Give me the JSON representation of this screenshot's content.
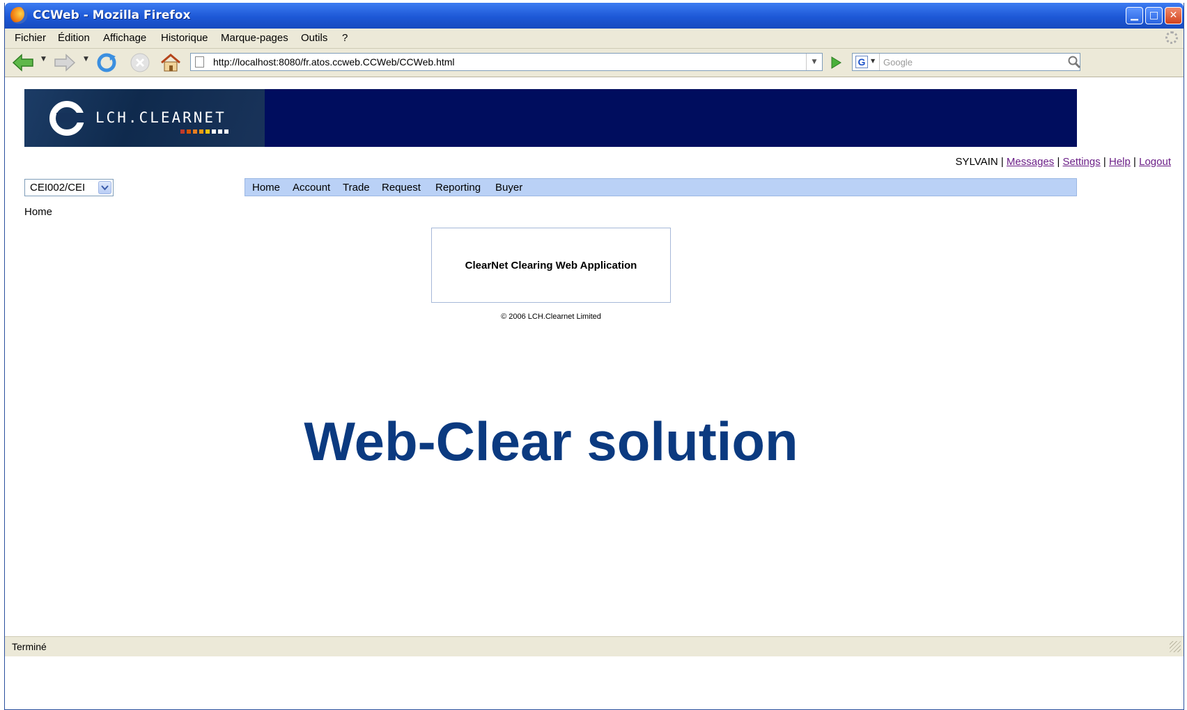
{
  "window": {
    "title": "CCWeb - Mozilla Firefox"
  },
  "menubar": [
    "Fichier",
    "Édition",
    "Affichage",
    "Historique",
    "Marque-pages",
    "Outils",
    "?"
  ],
  "navbar": {
    "url": "http://localhost:8080/fr.atos.ccweb.CCWeb/CCWeb.html",
    "search_placeholder": "Google"
  },
  "banner": {
    "brand": "LCH.CLEARNET",
    "bar_colors": [
      "#c0392b",
      "#d35400",
      "#e67e22",
      "#f39c12",
      "#f1c40f",
      "#ffffff",
      "#ffffff",
      "#ffffff"
    ]
  },
  "user": {
    "name": "SYLVAIN",
    "sep": "|",
    "links": [
      "Messages",
      "Settings",
      "Help",
      "Logout"
    ],
    "link_color": "#6b1f87"
  },
  "account_select": {
    "value": "CEI002/CEI"
  },
  "breadcrumb": "Home",
  "app_menu": [
    "Home",
    "Account",
    "Trade",
    "Request",
    "Reporting",
    "Buyer"
  ],
  "welcome": {
    "text": "ClearNet Clearing Web Application",
    "copyright": "© 2006 LCH.Clearnet Limited"
  },
  "overlay_title": "Web-Clear solution",
  "status": {
    "text": "Terminé"
  },
  "colors": {
    "banner_bg": "#000d5e",
    "menu_bg": "#bad1f6",
    "title_blue": "#0b3a80"
  }
}
